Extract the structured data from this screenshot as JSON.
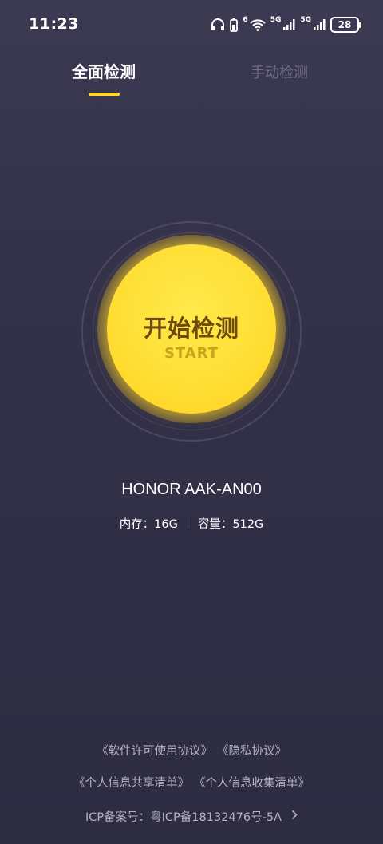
{
  "status_bar": {
    "time": "11:23",
    "network_label_1": "6",
    "network_label_2": "5G",
    "network_label_3": "5G",
    "battery": "28",
    "icons": [
      "headphones-icon",
      "battery-saver-icon",
      "wifi-icon",
      "signal-icon",
      "signal-icon",
      "battery-icon"
    ]
  },
  "tabs": [
    {
      "label": "全面检测",
      "active": true
    },
    {
      "label": "手动检测",
      "active": false
    }
  ],
  "start_button": {
    "label": "开始检测",
    "sublabel": "START"
  },
  "device": {
    "name": "HONOR AAK-AN00",
    "memory": "内存：16G",
    "storage": "容量：512G"
  },
  "footer": {
    "software_license": "《软件许可使用协议》",
    "privacy": "《隐私协议》",
    "info_share": "《个人信息共享清单》",
    "info_collect": "《个人信息收集清单》",
    "icp": "ICP备案号：粤ICP备18132476号-5A"
  },
  "colors": {
    "accent": "#ffd92b",
    "background_top": "#3c3a52",
    "background_bottom": "#2e2c41",
    "button_text": "#6e4a0a"
  }
}
